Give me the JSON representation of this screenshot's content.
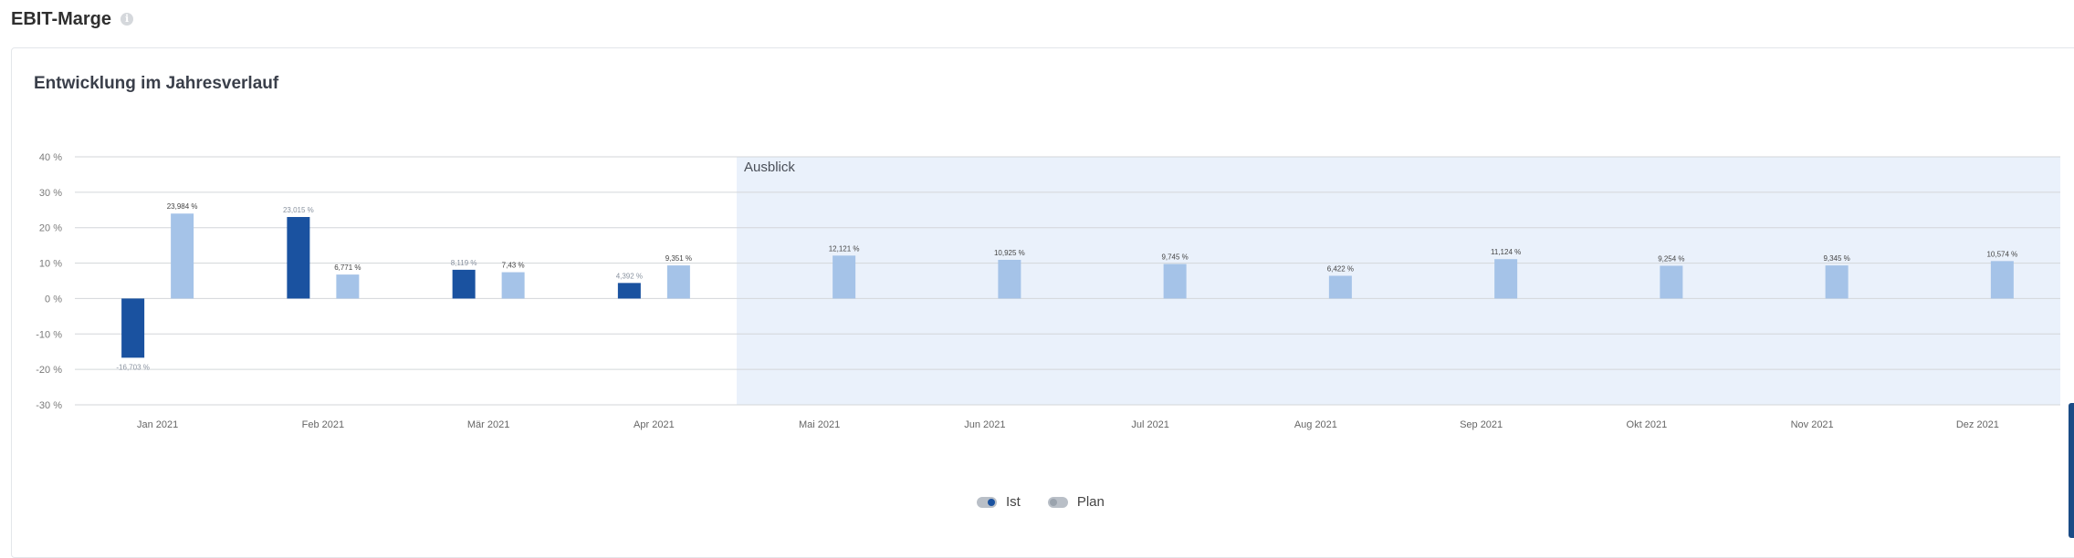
{
  "page": {
    "title": "EBIT-Marge",
    "info_icon": "info-icon"
  },
  "card": {
    "title": "Entwicklung im Jahresverlauf"
  },
  "chart_data": {
    "type": "bar",
    "categories": [
      "Jan 2021",
      "Feb 2021",
      "Mär 2021",
      "Apr 2021",
      "Mai 2021",
      "Jun 2021",
      "Jul 2021",
      "Aug 2021",
      "Sep 2021",
      "Okt 2021",
      "Nov 2021",
      "Dez 2021"
    ],
    "series": [
      {
        "name": "Ist",
        "color": "#1a52a0",
        "values": [
          -16.703,
          23.015,
          8.119,
          4.392,
          null,
          null,
          null,
          null,
          null,
          null,
          null,
          null
        ],
        "labels": [
          "-16,703 %",
          "23,015 %",
          "8,119 %",
          "4,392 %",
          "",
          "",
          "",
          "",
          "",
          "",
          "",
          ""
        ]
      },
      {
        "name": "Plan",
        "color": "#a5c3e8",
        "values": [
          23.984,
          6.771,
          7.43,
          9.351,
          12.121,
          10.925,
          9.745,
          6.422,
          11.124,
          9.254,
          9.345,
          10.574
        ],
        "labels": [
          "23,984 %",
          "6,771 %",
          "7,43 %",
          "9,351 %",
          "12,121 %",
          "10,925 %",
          "9,745 %",
          "6,422 %",
          "11,124 %",
          "9,254 %",
          "9,345 %",
          "10,574 %"
        ]
      }
    ],
    "yticks": [
      "40 %",
      "30 %",
      "20 %",
      "10 %",
      "0 %",
      "-10 %",
      "-20 %",
      "-30 %"
    ],
    "ylim": [
      -30,
      40
    ],
    "grid": true,
    "region": {
      "label": "Ausblick",
      "from_category": "Mai 2021",
      "color": "#eaf1fb"
    },
    "legend_position": "bottom-center"
  },
  "legend": [
    {
      "label": "Ist",
      "state": "on"
    },
    {
      "label": "Plan",
      "state": "off"
    }
  ]
}
